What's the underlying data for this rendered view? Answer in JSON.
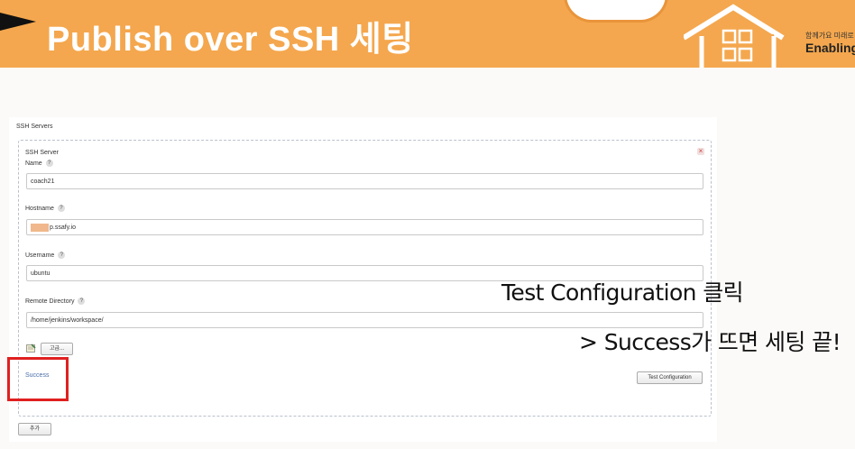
{
  "banner": {
    "title": "Publish over SSH 세팅",
    "logo_small": "함께가요 미래로",
    "logo_big": "Enabling"
  },
  "form": {
    "section_label": "SSH Servers",
    "server_label": "SSH Server",
    "help_glyph": "?",
    "close_glyph": "×",
    "fields": {
      "name_label": "Name",
      "name_value": "coach21",
      "hostname_label": "Hostname",
      "hostname_value": "p.ssafy.io",
      "username_label": "Username",
      "username_value": "ubuntu",
      "remote_dir_label": "Remote Directory",
      "remote_dir_value": "/home/jenkins/workspace/"
    },
    "advanced_button": "고급...",
    "status_text": "Success",
    "test_button": "Test Configuration",
    "add_button": "추가"
  },
  "annotation": {
    "line1": "Test Configuration 클릭",
    "line2": "> Success가 뜨면 세팅 끝!"
  },
  "colors": {
    "banner": "#f4a74e",
    "highlight_box": "#e02020",
    "success_text": "#4a6ea8"
  }
}
